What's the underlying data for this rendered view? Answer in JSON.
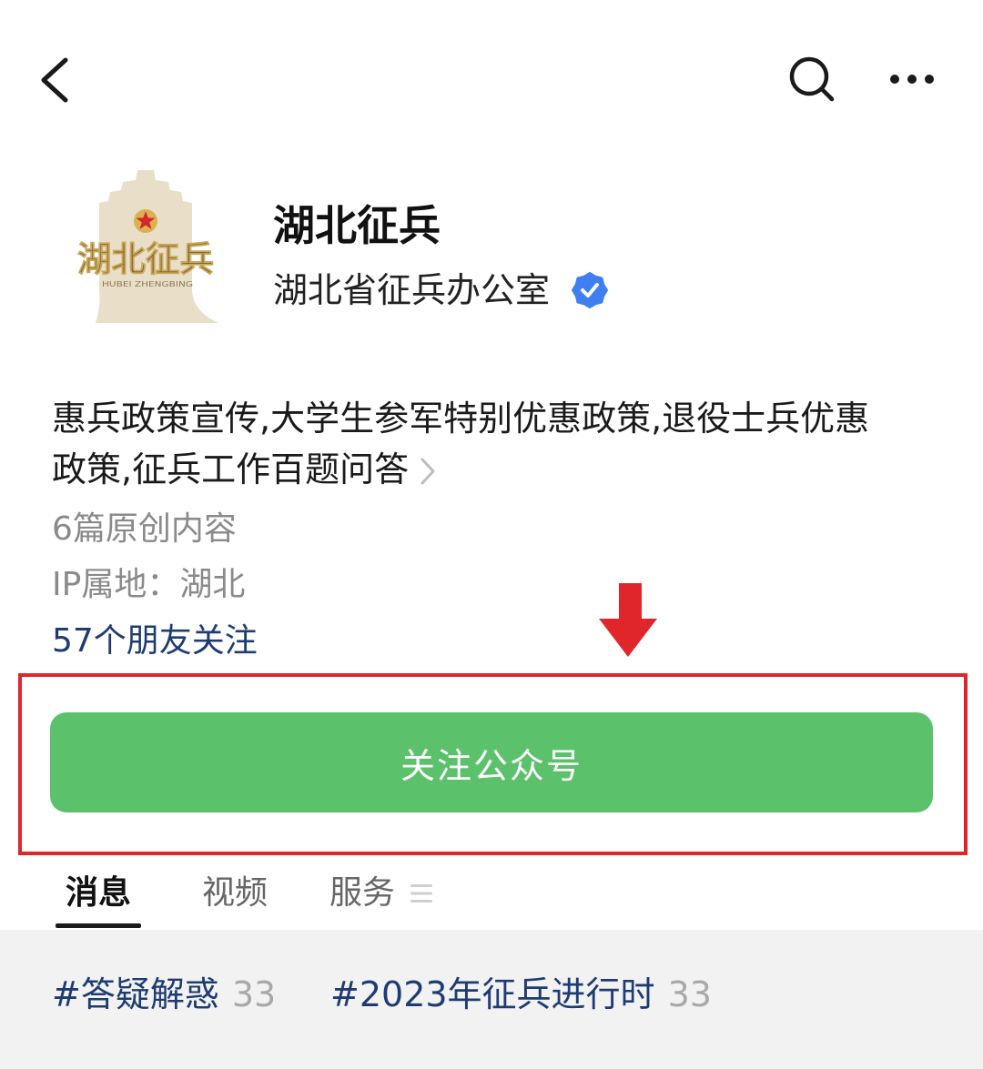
{
  "header": {
    "back_icon": "chevron-left-icon",
    "search_icon": "search-icon",
    "more_icon": "more-horizontal-icon"
  },
  "profile": {
    "logo": {
      "title": "湖北征兵",
      "subtitle": "HUBEI ZHENGBING",
      "emblem_icon": "red-star-icon"
    },
    "name": "湖北征兵",
    "organization": "湖北省征兵办公室",
    "verified_icon": "verified-badge-icon",
    "description": "惠兵政策宣传,大学生参军特别优惠政策,退役士兵优惠政策,征兵工作百题问答",
    "description_icon": "chevron-right-icon",
    "original_count": "6篇原创内容",
    "ip_location": "IP属地：湖北",
    "friends_following": "57个朋友关注"
  },
  "follow_button": {
    "label": "关注公众号"
  },
  "annotation": {
    "arrow_icon": "arrow-down-icon"
  },
  "tabs": [
    {
      "label": "消息",
      "active": true
    },
    {
      "label": "视频",
      "active": false
    },
    {
      "label": "服务",
      "active": false,
      "icon": "menu-lines-icon"
    }
  ],
  "tags": [
    {
      "label": "#答疑解惑",
      "count": "33"
    },
    {
      "label": "#2023年征兵进行时",
      "count": "33"
    }
  ],
  "colors": {
    "follow_green": "#5bc16b",
    "link_navy": "#1e3c72",
    "secondary_gray": "#8a8a8a",
    "verified_blue": "#3f7ff2",
    "annotation_red": "#e0252b",
    "section_background": "#f2f2f2"
  }
}
